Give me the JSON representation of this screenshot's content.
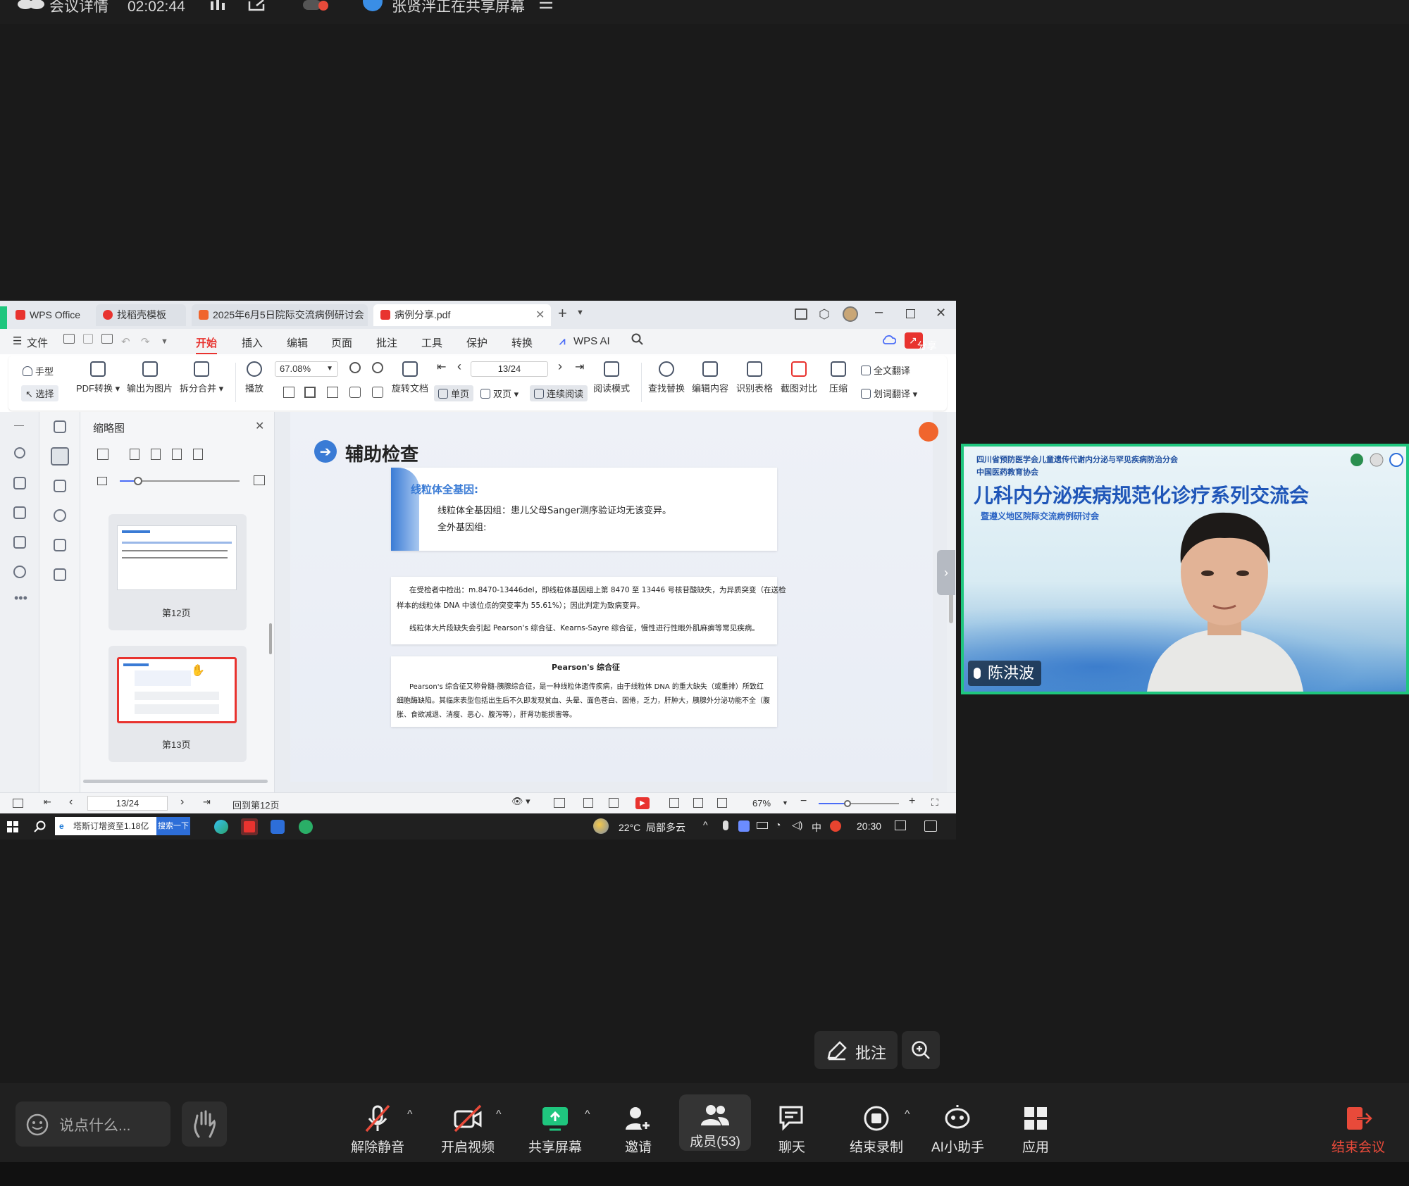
{
  "meeting": {
    "details_label": "会议详情",
    "timer": "02:02:44",
    "sharing_status": "张贤泮正在共享屏幕"
  },
  "wps": {
    "tabs": [
      {
        "label": "WPS Office"
      },
      {
        "label": "找稻壳模板"
      },
      {
        "label": "2025年6月5日院际交流病例研讨会"
      },
      {
        "label": "病例分享.pdf"
      }
    ],
    "menu": {
      "file": "文件",
      "items": [
        "开始",
        "插入",
        "编辑",
        "页面",
        "批注",
        "工具",
        "保护",
        "转换",
        "WPS AI"
      ],
      "share": "分享"
    },
    "ribbon": {
      "hand": "手型",
      "select": "选择",
      "pdf_convert": "PDF转换",
      "export_image": "输出为图片",
      "split_merge": "拆分合并",
      "play": "播放",
      "zoom": "67.08%",
      "rotate": "旋转文档",
      "page_input": "13/24",
      "single": "单页",
      "double": "双页",
      "continuous": "连续阅读",
      "read_mode": "阅读模式",
      "find_replace": "查找替换",
      "edit_content": "编辑内容",
      "recognize_table": "识别表格",
      "screenshot_compare": "截图对比",
      "compress": "压缩",
      "full_translate": "全文翻译",
      "word_translate": "划词翻译"
    },
    "thumbnails": {
      "title": "缩略图",
      "pages": [
        {
          "label": "第12页"
        },
        {
          "label": "第13页"
        }
      ]
    },
    "doc": {
      "heading": "辅助检查",
      "box1_title": "线粒体全基因:",
      "box1_line1": "线粒体全基因组：患儿父母Sanger测序验证均无该变异。",
      "box1_line2": "全外基因组:",
      "box2_line1": "在受检者中检出：m.8470-13446del，即线粒体基因组上第 8470 至 13446 号核苷酸缺失，为异质突变（在送检",
      "box2_line2": "样本的线粒体 DNA 中该位点的突变率为 55.61%）；因此判定为致病变异。",
      "box2_line3": "线粒体大片段缺失会引起 Pearson's 综合征、Kearns-Sayre 综合征，慢性进行性眼外肌麻痹等常见疾病。",
      "box3_title": "Pearson's 综合征",
      "box3_line1": "Pearson's 综合征又称骨髓-胰腺综合征，是一种线粒体遗传疾病，由于线粒体 DNA 的重大缺失（或重排）所致红",
      "box3_line2": "细胞酶缺陷。其临床表型包括出生后不久即发现贫血、头晕、面色苍白、困倦，乏力，肝肿大，胰腺外分泌功能不全（腹",
      "box3_line3": "胀、食欲减退、消瘦、恶心、腹泻等），肝肾功能损害等。"
    },
    "status": {
      "page": "13/24",
      "back": "回到第12页",
      "zoom": "67%"
    },
    "taskbar": {
      "search_news": "塔斯订增资至1.18亿",
      "search_btn": "搜索一下",
      "weather": "22°C  局部多云",
      "ime": "中",
      "time": "20:30"
    }
  },
  "video": {
    "banner_org1": "四川省预防医学会儿童遗传代谢内分泌与罕见疾病防治分会",
    "banner_org2": "中国医药教育协会",
    "banner_title": "儿科内分泌疾病规范化诊疗系列交流会",
    "banner_subtitle": "暨遵义地区院际交流病例研讨会",
    "speaker": "陈洪波"
  },
  "annotate": {
    "label": "批注"
  },
  "toolbar": {
    "chat_placeholder": "说点什么...",
    "unmute": "解除静音",
    "start_video": "开启视频",
    "share_screen": "共享屏幕",
    "invite": "邀请",
    "members": "成员(53)",
    "chat": "聊天",
    "end_record": "结束录制",
    "ai_assistant": "AI小助手",
    "apps": "应用",
    "leave": "结束会议"
  },
  "colors": {
    "accent_green": "#1fc67e",
    "danger_red": "#e84a3a",
    "wps_red": "#e8332f",
    "doc_blue": "#3a7bd5"
  }
}
